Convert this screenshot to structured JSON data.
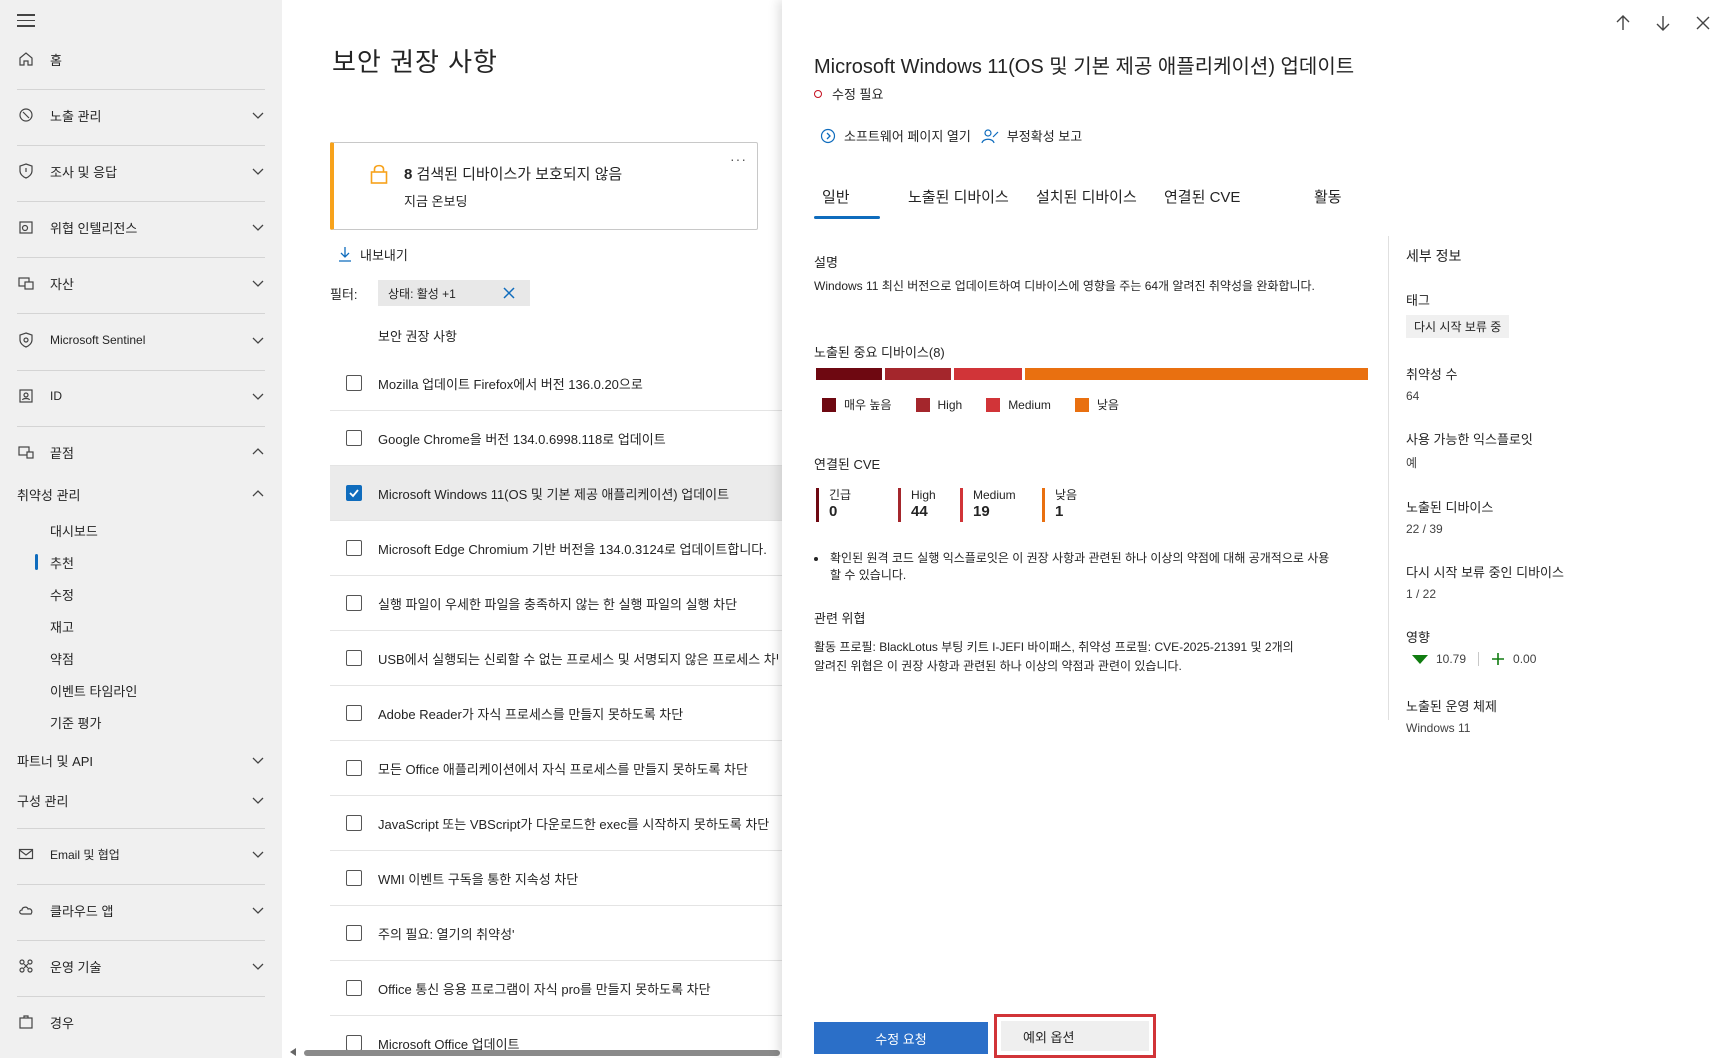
{
  "sidebar": {
    "items": [
      {
        "label": "홈",
        "icon": "home-icon"
      },
      {
        "label": "노출 관리",
        "icon": "exposure-icon"
      },
      {
        "label": "조사 및 응답",
        "icon": "shield-icon"
      },
      {
        "label": "위협 인텔리전스",
        "icon": "threat-intel-icon"
      },
      {
        "label": "자산",
        "icon": "assets-icon"
      },
      {
        "label": "Microsoft Sentinel",
        "icon": "sentinel-icon"
      },
      {
        "label": "ID",
        "icon": "identity-icon"
      },
      {
        "label": "끝점",
        "icon": "endpoint-icon"
      },
      {
        "label": "취약성 관리"
      },
      {
        "label": "파트너 및 API"
      },
      {
        "label": "구성 관리"
      },
      {
        "label": "Email 및 협업",
        "icon": "mail-icon"
      },
      {
        "label": "클라우드 앱",
        "icon": "cloud-icon"
      },
      {
        "label": "운영 기술",
        "icon": "ot-icon"
      },
      {
        "label": "경우",
        "icon": "cases-icon"
      }
    ],
    "sub_items": [
      "대시보드",
      "추천",
      "수정",
      "재고",
      "약점",
      "이벤트 타임라인",
      "기준 평가"
    ]
  },
  "main": {
    "title": "보안 권장 사항",
    "alert": {
      "count": "8",
      "title": "검색된 디바이스가 보호되지 않음",
      "sub": "지금 온보딩",
      "more": "···"
    },
    "export_label": "내보내기",
    "filter_label": "필터:",
    "filter_chip": "상태: 활성 +1",
    "column_header": "보안 권장 사항",
    "rows": [
      "Mozilla 업데이트  Firefox에서 버전 136.0.20으로",
      "Google Chrome을 버전 134.0.6998.118로 업데이트",
      "Microsoft Windows 11(OS 및 기본 제공 애플리케이션) 업데이트",
      "Microsoft Edge Chromium 기반 버전을 134.0.3124로 업데이트합니다.",
      "실행 파일이 우세한 파일을 충족하지 않는 한 실행 파일의 실행 차단",
      "USB에서 실행되는 신뢰할 수 없는 프로세스 및 서명되지 않은 프로세스 차단",
      "Adobe Reader가 자식 프로세스를 만들지 못하도록 차단",
      "모든 Office 애플리케이션에서 자식 프로세스를 만들지 못하도록 차단",
      "JavaScript 또는 VBScript가 다운로드한 exec를 시작하지 못하도록 차단",
      "WMI 이벤트 구독을 통한 지속성 차단",
      "주의 필요: 열기의 취약성'",
      "Office 통신 응용 프로그램이 자식 pro를 만들지 못하도록 차단",
      "Microsoft Office 업데이트"
    ]
  },
  "panel": {
    "title": "Microsoft Windows 11(OS 및 기본 제공 애플리케이션) 업데이트",
    "status": "수정 필요",
    "actions": [
      "소프트웨어 페이지 열기",
      "부정확성 보고"
    ],
    "tabs": [
      "일반",
      "노출된 디바이스",
      "설치된 디바이스",
      "연결된 CVE",
      "활동"
    ],
    "description_label": "설명",
    "description": "Windows 11 최신 버전으로 업데이트하여 디바이스에 영향을 주는 64개 알려진 취약성을 완화합니다.",
    "exposed_label": "노출된 중요 디바이스(8)",
    "severity_legend": [
      {
        "label": "매우 높음",
        "color": "#6e0811"
      },
      {
        "label": "High",
        "color": "#a4262c"
      },
      {
        "label": "Medium",
        "color": "#d13438"
      },
      {
        "label": "낮음",
        "color": "#e97010"
      }
    ],
    "cve_label": "연결된 CVE",
    "cves": [
      {
        "label": "긴급",
        "value": "0",
        "color": "#6e0811"
      },
      {
        "label": "High",
        "value": "44",
        "color": "#a4262c"
      },
      {
        "label": "Medium",
        "value": "19",
        "color": "#d13438"
      },
      {
        "label": "낮음",
        "value": "1",
        "color": "#e97010"
      }
    ],
    "bullet": "확인된 원격 코드 실행 익스플로잇은 이 권장 사항과 관련된 하나 이상의 약점에 대해 공개적으로 사용할 수 있습니다.",
    "threat_label": "관련 위협",
    "threat": "활동 프로필: BlackLotus 부팅 키트 I-JEFI 바이패스, 취약성 프로필: CVE-2025-21391 및 2개의 알려진 위협은 이 권장 사항과 관련된 하나 이상의 약점과 관련이 있습니다.",
    "details": {
      "heading": "세부 정보",
      "tag_label": "태그",
      "tag_value": "다시 시작 보류 중",
      "vuln_count_label": "취약성 수",
      "vuln_count": "64",
      "exploit_label": "사용 가능한 익스플로잇",
      "exploit_value": "예",
      "exposed_label": "노출된 디바이스",
      "exposed_value": "22 / 39",
      "restart_label": "다시 시작 보류 중인 디바이스",
      "restart_value": "1 / 22",
      "impact_label": "영향",
      "impact_down": "10.79",
      "impact_up": "0.00",
      "os_label": "노출된 운영 체제",
      "os_value": "Windows 11"
    },
    "buttons": {
      "remediate": "수정 요청",
      "exception": "예외 옵션"
    }
  },
  "colors": {
    "accent": "#0f6cbd",
    "warning": "#f7a21b",
    "highlight": "#d13438"
  }
}
